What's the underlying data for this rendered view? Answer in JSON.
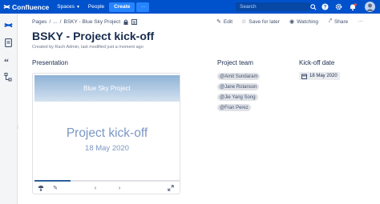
{
  "topbar": {
    "product_name": "Confluence",
    "nav": [
      {
        "label": "Spaces",
        "has_menu": true
      },
      {
        "label": "People",
        "has_menu": false
      }
    ],
    "create_label": "Create",
    "more_label": "···",
    "search_placeholder": "Search"
  },
  "breadcrumb": {
    "items": [
      "Pages",
      "...",
      "BSKY - Blue Sky Project"
    ],
    "separator": "/"
  },
  "page_actions": {
    "edit": "Edit",
    "save_for_later": "Save for later",
    "watching": "Watching",
    "share": "Share",
    "more": "···"
  },
  "page": {
    "title": "BSKY - Project kick-off",
    "byline": "Created by Rach Admin, last modified just a moment ago"
  },
  "presentation": {
    "heading": "Presentation",
    "slide_banner_text": "Blue Sky Project",
    "slide_title": "Project kick-off",
    "slide_date": "18 May 2020",
    "progress_fraction": 0.25
  },
  "project_team": {
    "heading": "Project team",
    "members": [
      "@Amit Sundaram",
      "@Jane Rotanson",
      "@Jie Yang Song",
      "@Fran Perez"
    ]
  },
  "kickoff": {
    "heading": "Kick-off date",
    "date": "18 May 2020"
  },
  "colors": {
    "topbar": "#0052cc",
    "create_button": "#2684ff",
    "slide_text": "#7b97c4",
    "progress_fill": "#2c5f9e"
  }
}
